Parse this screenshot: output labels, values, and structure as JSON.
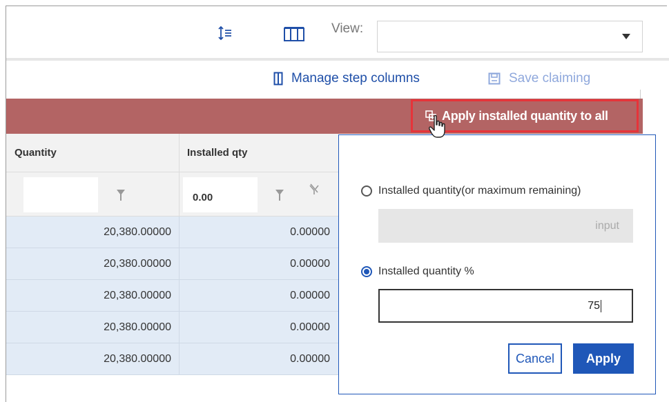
{
  "toolbar": {
    "row_height_icon": "row-height-icon",
    "columns_icon": "columns-icon",
    "view_label": "View:",
    "view_value": ""
  },
  "actions": {
    "manage_label": "Manage step columns",
    "save_label": "Save claiming",
    "apply_all_label": "Apply installed quantity to all"
  },
  "grid": {
    "columns": [
      "Quantity",
      "Installed qty"
    ],
    "filter_installed_value": "0.00",
    "rows": [
      {
        "quantity": "20,380.00000",
        "installed": "0.00000"
      },
      {
        "quantity": "20,380.00000",
        "installed": "0.00000"
      },
      {
        "quantity": "20,380.00000",
        "installed": "0.00000"
      },
      {
        "quantity": "20,380.00000",
        "installed": "0.00000"
      },
      {
        "quantity": "20,380.00000",
        "installed": "0.00000"
      }
    ]
  },
  "popup": {
    "option1_label": "Installed quantity(or maximum remaining)",
    "option1_placeholder": "input",
    "option2_label": "Installed quantity %",
    "percent_value": "75",
    "cancel_label": "Cancel",
    "apply_label": "Apply"
  },
  "colors": {
    "accent": "#1f57b8",
    "band": "#b36464",
    "highlight": "#e6343a",
    "row_bg": "#e2ebf6"
  }
}
